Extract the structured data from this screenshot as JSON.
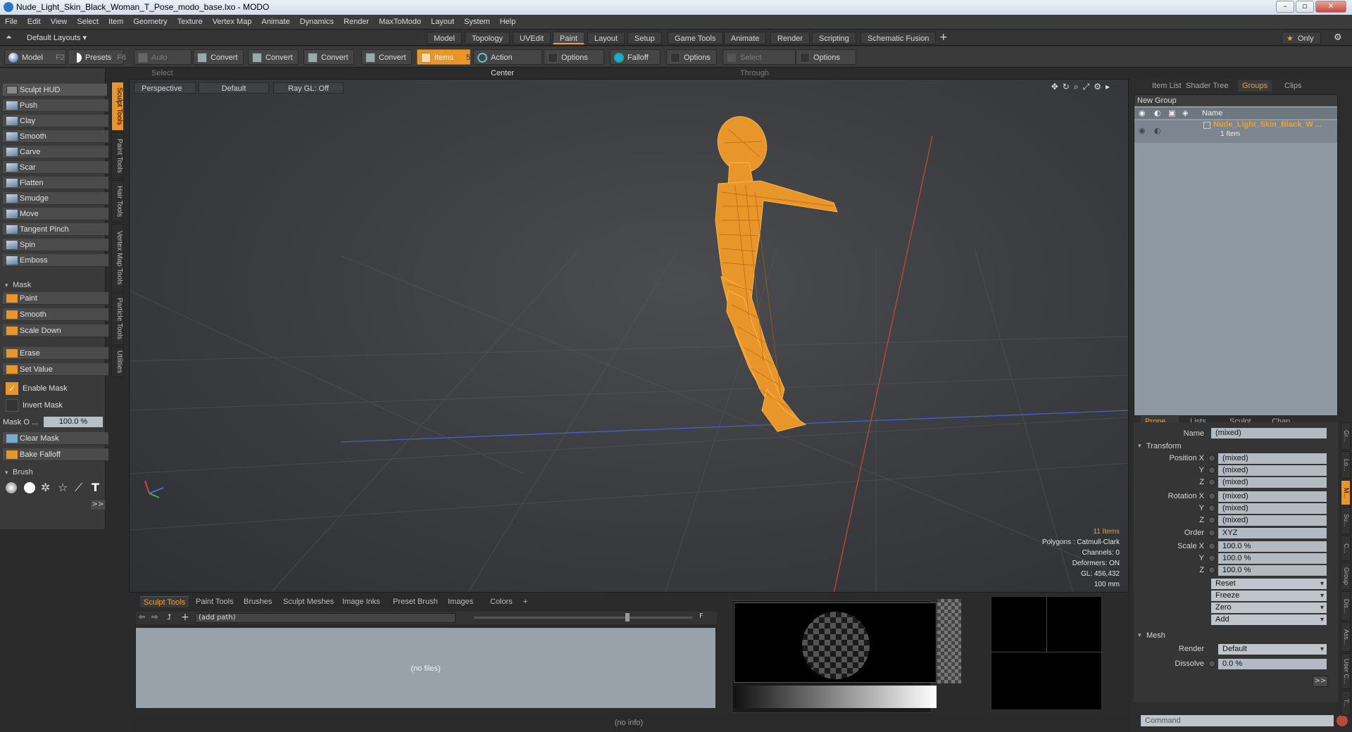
{
  "window": {
    "title": "Nude_Light_Skin_Black_Woman_T_Pose_modo_base.lxo - MODO"
  },
  "menu": [
    "File",
    "Edit",
    "View",
    "Select",
    "Item",
    "Geometry",
    "Texture",
    "Vertex Map",
    "Animate",
    "Dynamics",
    "Render",
    "MaxToModo",
    "Layout",
    "System",
    "Help"
  ],
  "layoutbar": {
    "layouts_label": "Default Layouts",
    "tabs": [
      "Model",
      "Topology",
      "UVEdit",
      "Paint",
      "Layout",
      "Setup",
      "Game Tools",
      "Animate",
      "Render",
      "Scripting",
      "Schematic Fusion"
    ],
    "active_tab": "Paint",
    "add": "+",
    "only_label": "Only"
  },
  "toolbar": {
    "model": "Model",
    "model_key": "F2",
    "presets": "Presets",
    "presets_key": "F6",
    "auto_select": "Auto Select",
    "convert1": "Convert",
    "convert2": "Convert",
    "convert3": "Convert",
    "convert4": "Convert",
    "items": "Items",
    "items_key": "5",
    "action_center": "Action Center",
    "options1": "Options",
    "falloff": "Falloff",
    "options2": "Options",
    "select_through": "Select Through",
    "options3": "Options"
  },
  "left": {
    "hud": "Sculpt HUD",
    "tools": [
      "Push",
      "Clay",
      "Smooth",
      "Carve",
      "Scar",
      "Flatten",
      "Smudge",
      "Move",
      "Tangent Pinch",
      "Spin",
      "Emboss"
    ],
    "mask_section": "Mask",
    "mask_tools": [
      "Paint",
      "Smooth",
      "Scale Down"
    ],
    "erase": "Erase",
    "set_value": "Set Value",
    "enable_mask": "Enable Mask",
    "invert_mask": "Invert Mask",
    "mask_opacity_label": "Mask O ...",
    "mask_opacity_value": "100.0 %",
    "clear_mask": "Clear Mask",
    "bake_falloff": "Bake Falloff",
    "brush_section": "Brush",
    "more": ">>"
  },
  "vtabs": [
    "Sculpt Tools",
    "Paint Tools",
    "Hair Tools",
    "Vertex Map Tools",
    "Particle Tools",
    "Utilities"
  ],
  "viewport": {
    "view": "Perspective",
    "style": "Default",
    "raygl": "Ray GL: Off",
    "info": {
      "items": "11 Items",
      "polygons": "Polygons : Catmull-Clark",
      "channels": "Channels: 0",
      "deformers": "Deformers: ON",
      "gl": "GL: 456,432",
      "scale": "100 mm"
    },
    "mesh_color": "#f0a030"
  },
  "bottom": {
    "tabs": [
      "Sculpt Tools",
      "Paint Tools",
      "Brushes",
      "Sculpt Meshes",
      "Image Inks",
      "Preset Brush",
      "Images",
      "Colors"
    ],
    "add": "+",
    "path_placeholder": "(add path)",
    "f_btn": "F",
    "no_files": "(no files)"
  },
  "status": "(no info)",
  "right": {
    "tabs": [
      "Item List",
      "Shader Tree",
      "Groups",
      "Clips"
    ],
    "active_tab": "Groups",
    "new_group": "New Group",
    "col_name": "Name",
    "group_name": "Nude_Light_Skin_Black_W ...",
    "group_count": "1 Item",
    "prop_tabs": [
      "Prope ...",
      "Lists",
      "Sculpt",
      "Chan ..."
    ],
    "name_label": "Name",
    "name_value": "(mixed)",
    "transform": "Transform",
    "pos_label": "Position X",
    "rot_label": "Rotation X",
    "scale_label": "Scale X",
    "y": "Y",
    "z": "Z",
    "mixed": "(mixed)",
    "order_label": "Order",
    "order_value": "XYZ",
    "scale_value": "100.0 %",
    "reset": "Reset",
    "freeze": "Freeze",
    "zero": "Zero",
    "add": "Add",
    "mesh": "Mesh",
    "render_label": "Render",
    "render_value": "Default",
    "dissolve_label": "Dissolve",
    "dissolve_value": "0.0 %",
    "more": ">>",
    "command_placeholder": "Command",
    "side_tabs": [
      "Gr...",
      "Lo...",
      "M...",
      "Su...",
      "C...",
      "Group",
      "Dis...",
      "Ass...",
      "User C...",
      "T..."
    ]
  }
}
